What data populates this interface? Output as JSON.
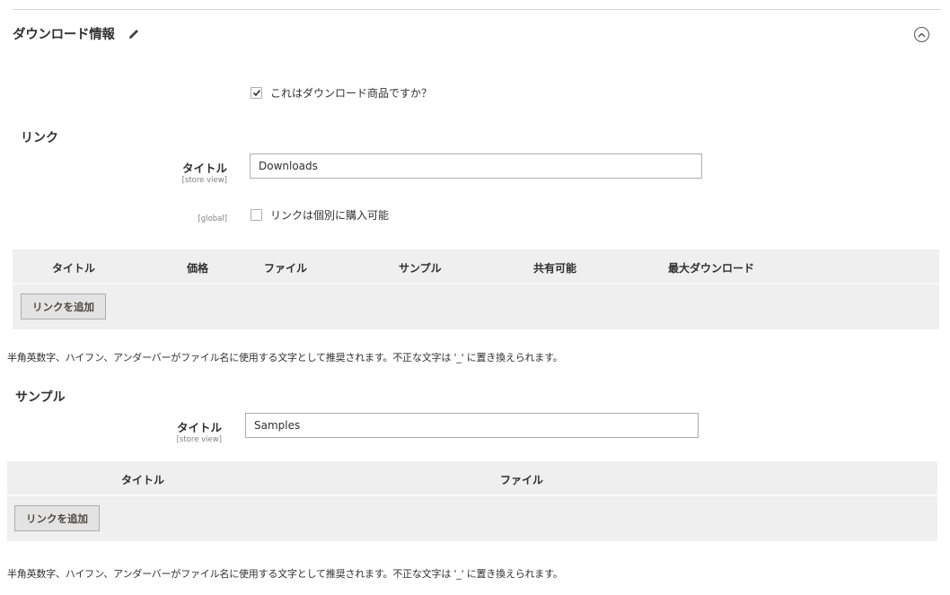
{
  "section": {
    "title": "ダウンロード情報",
    "edit_icon": "pencil-icon",
    "collapse_icon": "chevron-up-circle-icon"
  },
  "downloadable": {
    "label": "これはダウンロード商品ですか？",
    "checked": true
  },
  "links": {
    "heading": "リンク",
    "title_field": {
      "label": "タイトル",
      "scope": "[store view]",
      "value": "Downloads"
    },
    "separately": {
      "scope": "[global]",
      "label": "リンクは個別に購入可能",
      "checked": false
    },
    "grid": {
      "columns": [
        "タイトル",
        "価格",
        "ファイル",
        "サンプル",
        "共有可能",
        "最大ダウンロード"
      ],
      "add_button": "リンクを追加"
    },
    "note": "半角英数字、ハイフン、アンダーバーがファイル名に使用する文字として推奨されます。不正な文字は '_' に置き換えられます。"
  },
  "samples": {
    "heading": "サンプル",
    "title_field": {
      "label": "タイトル",
      "scope": "[store view]",
      "value": "Samples"
    },
    "grid": {
      "columns": [
        "タイトル",
        "ファイル"
      ],
      "add_button": "リンクを追加"
    },
    "note": "半角英数字、ハイフン、アンダーバーがファイル名に使用する文字として推奨されます。不正な文字は '_' に置き換えられます。"
  }
}
